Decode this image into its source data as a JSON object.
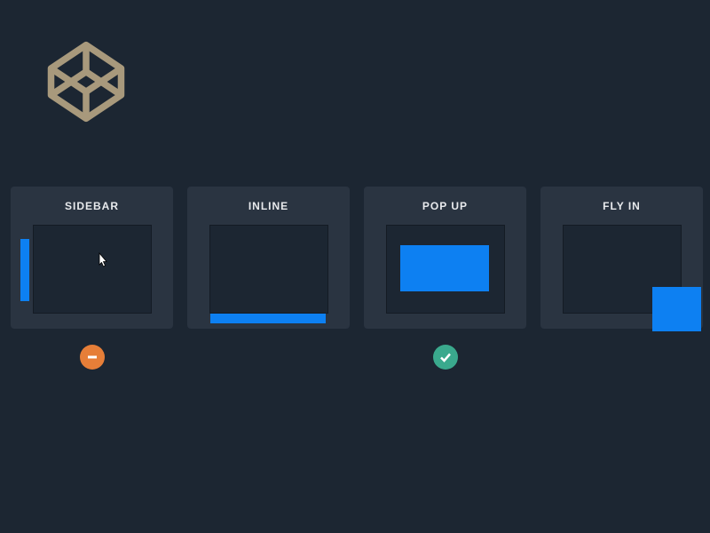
{
  "colors": {
    "bg": "#1c2632",
    "card_bg": "#2a3441",
    "preview_bg": "#1c2632",
    "accent": "#0d80f2",
    "badge_remove": "#e67e38",
    "badge_ok": "#3aa98d",
    "logo": "#a8997c",
    "text": "#e8eaed"
  },
  "cards": [
    {
      "title": "SIDEBAR",
      "variant": "sidebar",
      "status": "remove"
    },
    {
      "title": "INLINE",
      "variant": "inline",
      "status": "none"
    },
    {
      "title": "POP UP",
      "variant": "popup",
      "status": "ok"
    },
    {
      "title": "FLY IN",
      "variant": "flyin",
      "status": "none"
    }
  ],
  "icons": {
    "remove": "minus-icon",
    "ok": "check-icon"
  }
}
